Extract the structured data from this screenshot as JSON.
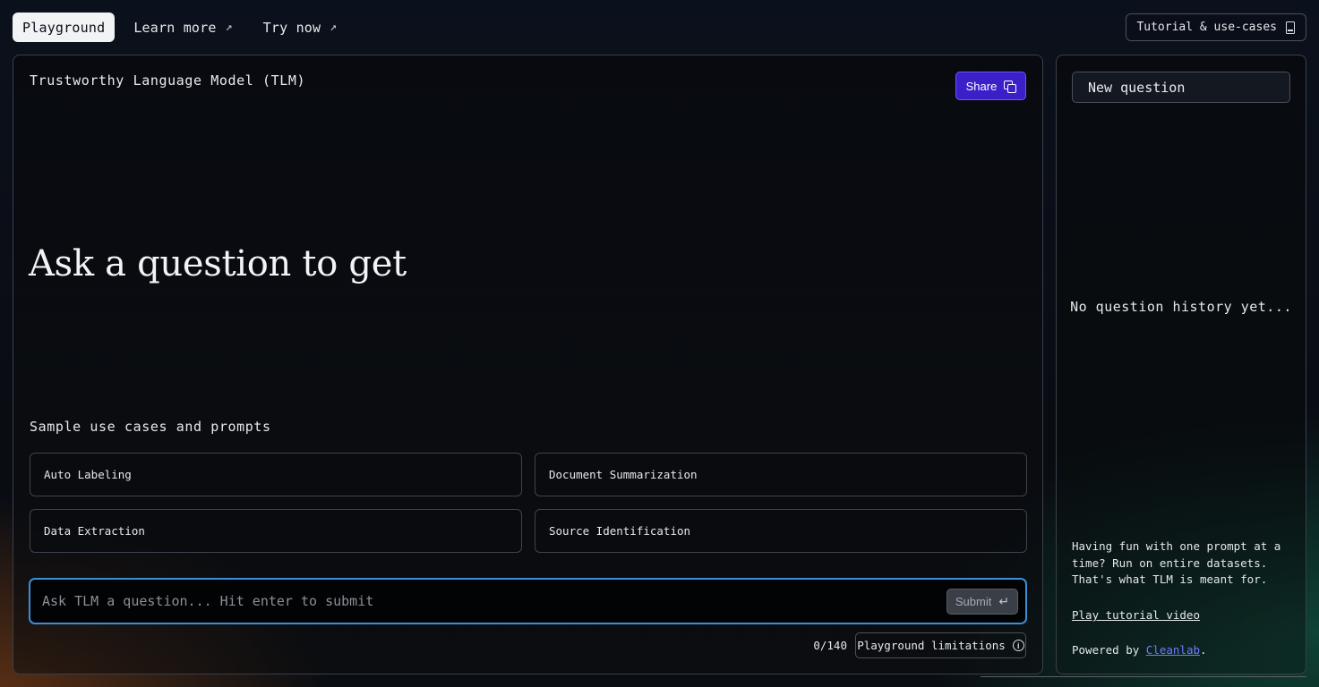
{
  "nav": {
    "playground": "Playground",
    "learn_more": "Learn more",
    "try_now": "Try now",
    "arrow": "↗",
    "tutorial": "Tutorial & use-cases"
  },
  "main": {
    "title": "Trustworthy Language Model (TLM)",
    "share_label": "Share",
    "headline": "Ask a question to get",
    "samples_title": "Sample use cases and prompts",
    "samples": [
      "Auto Labeling",
      "Document Summarization",
      "Data Extraction",
      "Source Identification"
    ],
    "input_placeholder": "Ask TLM a question... Hit enter to submit",
    "input_value": "",
    "submit_label": "Submit",
    "enter_glyph": "↵",
    "char_count": "0/140",
    "limits_label": "Playground limitations",
    "info_glyph": "i"
  },
  "side": {
    "new_question": "New question",
    "empty_history": "No question history yet...",
    "promo": "Having fun with one prompt at a time? Run on entire datasets. That's what TLM is meant for.",
    "tutorial_link": "Play tutorial video",
    "powered_prefix": "Powered by ",
    "powered_link": "Cleanlab",
    "powered_suffix": "."
  },
  "colors": {
    "share_bg": "#3b1fc9",
    "input_border": "#3b8fd8",
    "link": "#6f7dff"
  }
}
